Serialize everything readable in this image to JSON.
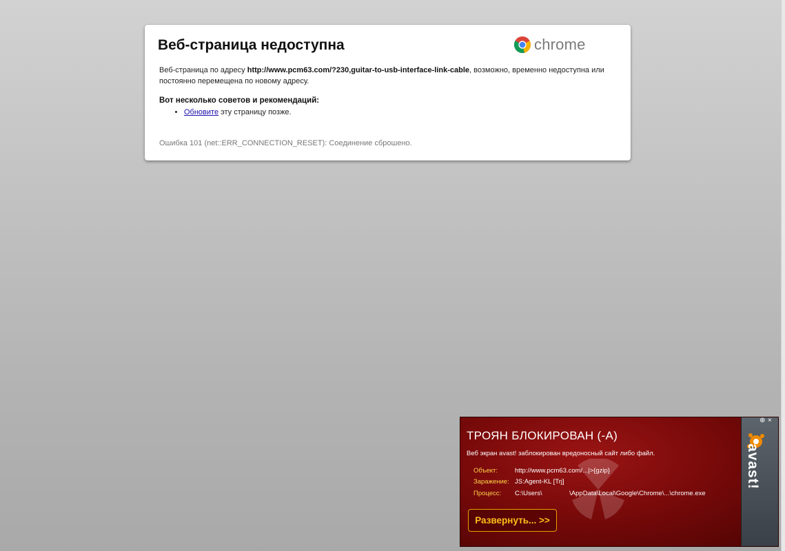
{
  "error_page": {
    "title": "Веб-страница недоступна",
    "brand": "chrome",
    "desc_prefix": "Веб-страница по адресу ",
    "url": "http://www.pcm63.com/?230,guitar-to-usb-interface-link-cable",
    "desc_suffix": ", возможно, временно недоступна или постоянно перемещена по новому адресу.",
    "tips_heading": "Вот несколько советов и рекомендаций:",
    "tips": [
      {
        "link": "Обновите",
        "text": " эту страницу позже."
      }
    ],
    "error_text": "Ошибка 101 (net::ERR_CONNECTION_RESET): Соединение сброшено."
  },
  "avast": {
    "title": "ТРОЯН БЛОКИРОВАН (-А)",
    "message": "Веб экран avast! заблокирован вредоносный сайт либо файл.",
    "object_label": "Объект:",
    "object_value": "http://www.pcm63.com/...|>{gzip}",
    "infection_label": "Заражение:",
    "infection_value": "JS:Agent-KL [Trj]",
    "process_label": "Процесс:",
    "process_value": "C:\\Users\\               \\AppData\\Local\\Google\\Chrome\\...\\chrome.exe",
    "expand_button": "Развернуть... >>",
    "brand": "avast!",
    "pin_glyph": "⊕",
    "close_glyph": "×",
    "accent_color": "#ffbf1a",
    "background_color": "#7a0a0a"
  },
  "colors": {
    "page_background": "#c2c2c2",
    "link": "#1a0dab"
  }
}
